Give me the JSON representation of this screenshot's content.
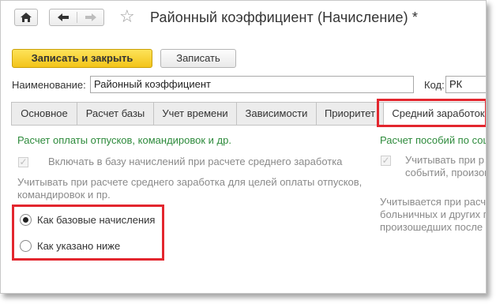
{
  "header": {
    "title": "Районный коэффициент (Начисление) *"
  },
  "toolbar": {
    "save_close_label": "Записать и закрыть",
    "save_label": "Записать"
  },
  "fields": {
    "name_label": "Наименование:",
    "name_value": "Районный коэффициент",
    "code_label": "Код:",
    "code_value": "РК"
  },
  "tabs": [
    {
      "label": "Основное"
    },
    {
      "label": "Расчет базы"
    },
    {
      "label": "Учет времени"
    },
    {
      "label": "Зависимости"
    },
    {
      "label": "Приоритет"
    },
    {
      "label": "Средний заработок"
    }
  ],
  "left_panel": {
    "heading": "Расчет оплаты отпусков, командировок и др.",
    "checkbox_label": "Включать в базу начислений при расчете среднего заработка",
    "description_line1": "Учитывать при расчете среднего заработка для целей оплаты отпусков,",
    "description_line2": "командировок и пр.",
    "radio_options": [
      {
        "label": "Как базовые начисления",
        "selected": true
      },
      {
        "label": "Как указано ниже",
        "selected": false
      }
    ]
  },
  "right_panel": {
    "heading": "Расчет пособий по соц",
    "checkbox_line1": "Учитывать при р",
    "checkbox_line2": "событий, произош",
    "desc_line1": "Учитывается при расч",
    "desc_line2": "больничных и других п",
    "desc_line3": "произошедших после"
  },
  "colors": {
    "accent_yellow": "#f3c419",
    "green_text": "#2e8b3c",
    "highlight_red": "#e3262e"
  },
  "icons": {
    "home": "home-icon",
    "back": "arrow-left-icon",
    "forward": "arrow-right-icon",
    "favorite": "star-icon"
  }
}
